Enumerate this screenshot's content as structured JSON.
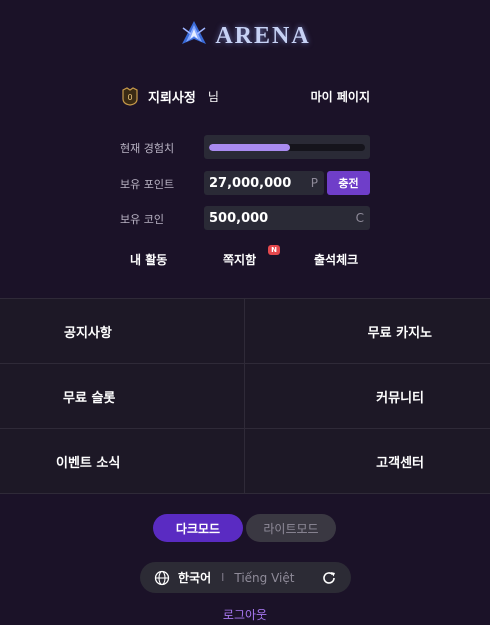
{
  "header": {
    "logo_text": "ARENA"
  },
  "user": {
    "name": "지뢰사정",
    "suffix": "님",
    "rank_badge": "0",
    "mypage_label": "마이 페이지"
  },
  "stats": {
    "exp_label": "현재 경험치",
    "exp_progress": 0.52,
    "points_label": "보유 포인트",
    "points_value": "27,000,000",
    "points_unit": "P",
    "charge_label": "충전",
    "coins_label": "보유 코인",
    "coins_value": "500,000",
    "coins_unit": "C"
  },
  "quick_links": {
    "activity": "내 활동",
    "messages": "쪽지함",
    "messages_badge": "N",
    "attendance": "출석체크"
  },
  "menu": {
    "notice": "공지사항",
    "free_casino": "무료 카지노",
    "free_slot": "무료 슬롯",
    "community": "커뮤니티",
    "events": "이벤트 소식",
    "support": "고객센터"
  },
  "theme": {
    "dark_label": "다크모드",
    "light_label": "라이트모드",
    "selected": "dark"
  },
  "language": {
    "current": "한국어",
    "separator": "I",
    "other": "Tiếng Việt"
  },
  "footer": {
    "logout_label": "로그아웃"
  },
  "colors": {
    "background": "#1b1228",
    "accent": "#6f3ec9",
    "exp_fill": "#a98bf0",
    "logout": "#a777f0",
    "badge": "#e5484d"
  }
}
